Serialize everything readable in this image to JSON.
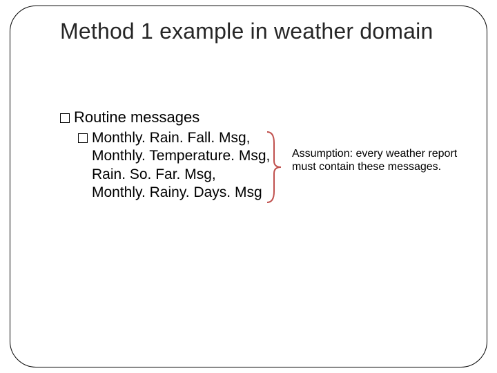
{
  "title": "Method 1 example in weather domain",
  "bullets": {
    "lvl1": "Routine messages",
    "lvl2_prefix": "Monthly. Rain. Fall. Msg,",
    "lvl2_lines": [
      "Monthly. Temperature. Msg,",
      "Rain. So. Far. Msg,",
      "Monthly. Rainy. Days. Msg"
    ]
  },
  "annotation": "Assumption: every weather report must contain these messages."
}
